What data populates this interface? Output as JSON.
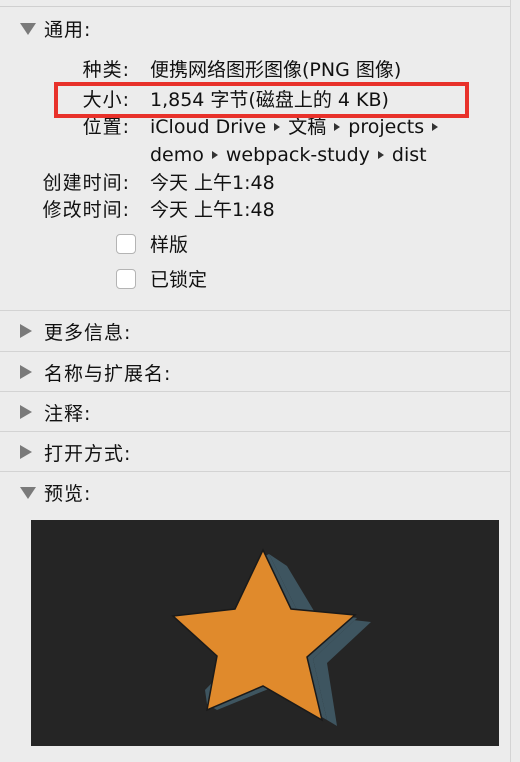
{
  "general": {
    "title": "通用:",
    "kind_label": "种类:",
    "kind_value": "便携网络图形图像(PNG 图像)",
    "size_label": "大小:",
    "size_value": "1,854 字节(磁盘上的 4 KB)",
    "where_label": "位置:",
    "where_path_line1": [
      "iCloud Drive",
      "文稿",
      "projects"
    ],
    "where_path_line2": [
      "demo",
      "webpack-study",
      "dist"
    ],
    "created_label": "创建时间:",
    "created_value": "今天 上午1:48",
    "modified_label": "修改时间:",
    "modified_value": "今天 上午1:48",
    "stationery_label": "样版",
    "stationery_checked": false,
    "locked_label": "已锁定",
    "locked_checked": false
  },
  "sections": {
    "more_info": "更多信息:",
    "name_ext": "名称与扩展名:",
    "comments": "注释:",
    "open_with": "打开方式:",
    "preview": "预览:"
  },
  "colors": {
    "highlight": "#e8312a",
    "star_face": "#e08a2c",
    "star_side": "#3e5560",
    "preview_bg": "#252525"
  }
}
